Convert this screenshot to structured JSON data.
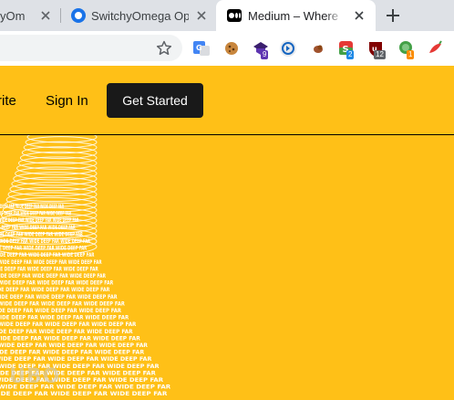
{
  "browser": {
    "tabs": [
      {
        "title": "SwitchyOmega Op",
        "truncated_title": "yOm"
      },
      {
        "title": "SwitchyOmega Op"
      },
      {
        "title": "Medium – Where "
      }
    ],
    "extensions": [
      {
        "icon": "google-translate-icon",
        "badge": ""
      },
      {
        "icon": "cookie-icon",
        "badge": ""
      },
      {
        "icon": "shield-extension-icon",
        "badge": "9"
      },
      {
        "icon": "circle-extension-icon",
        "badge": ""
      },
      {
        "icon": "bookmark-extension-icon",
        "badge": ""
      },
      {
        "icon": "script-extension-icon",
        "badge": "2"
      },
      {
        "icon": "ublock-icon",
        "badge": "12"
      },
      {
        "icon": "green-dot-extension-icon",
        "badge": "1"
      },
      {
        "icon": "chili-extension-icon",
        "badge": ""
      }
    ]
  },
  "page": {
    "nav": {
      "write": "Write",
      "write_visible": "rite",
      "sign_in": "Sign In",
      "get_started": "Get Started"
    },
    "art_text": "WIDE DEEP FAR",
    "watermark": "UBO"
  },
  "colors": {
    "brand_yellow": "#ffc017",
    "button_dark": "#191919",
    "tabstrip": "#dee1e6"
  }
}
